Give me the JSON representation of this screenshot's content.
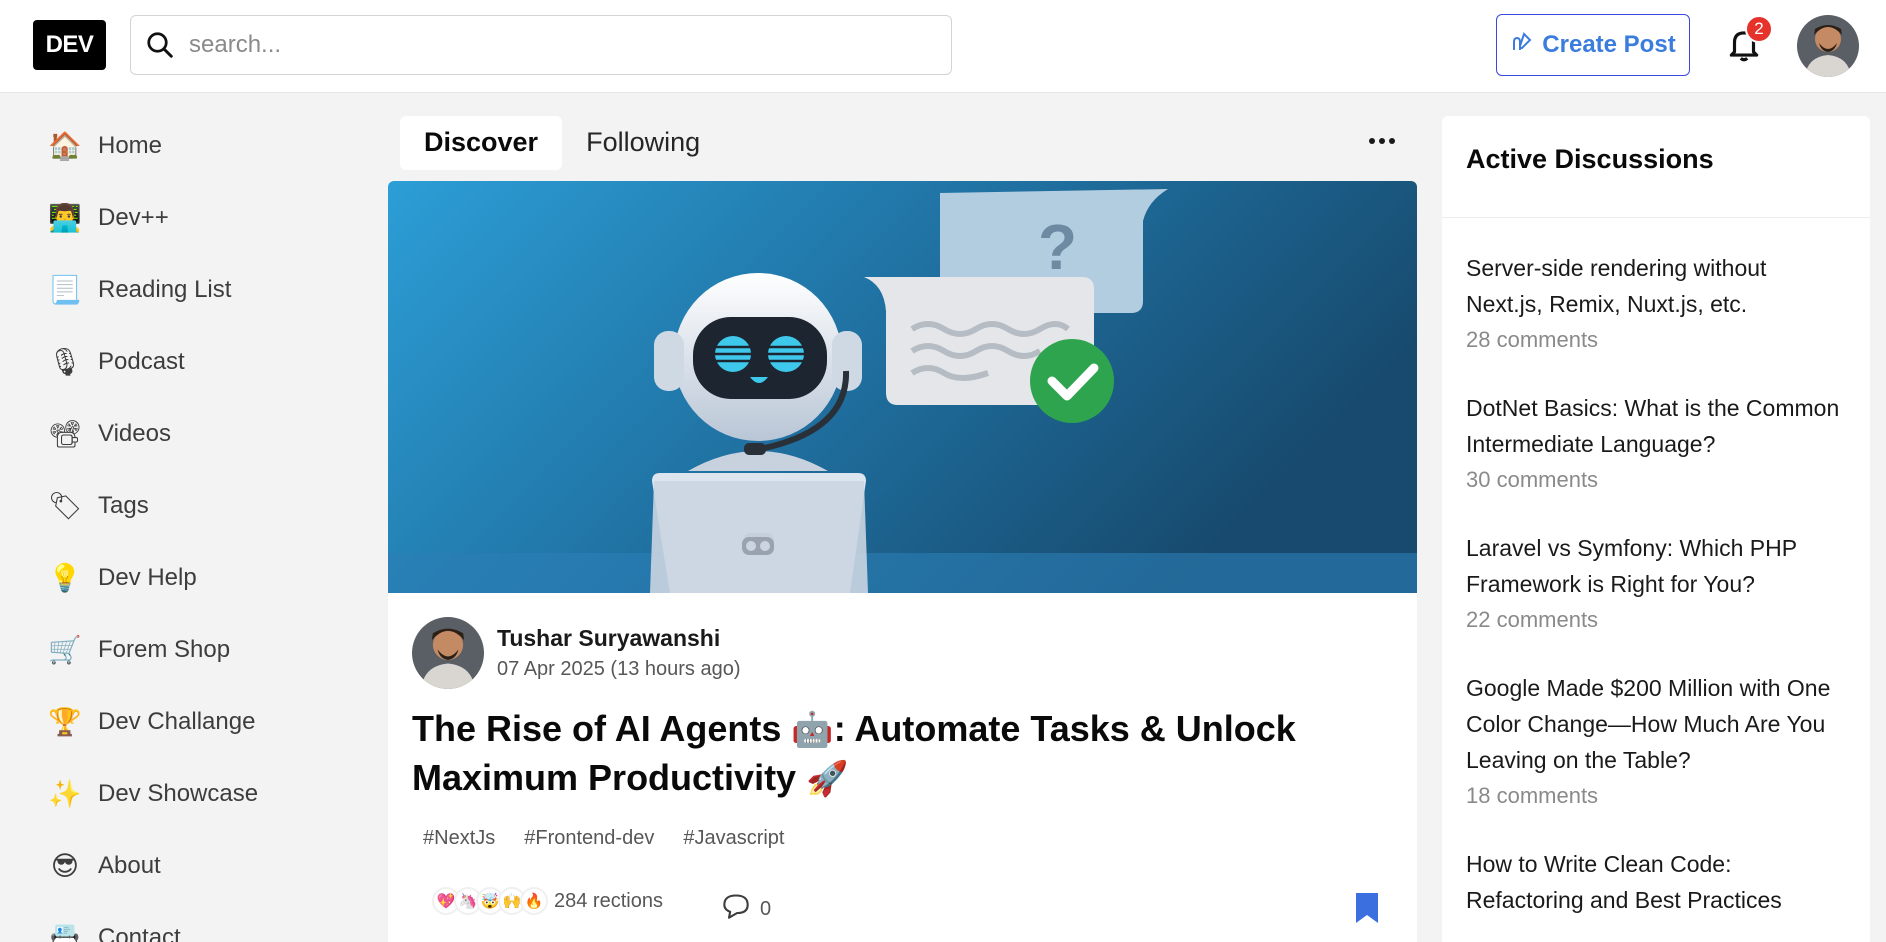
{
  "header": {
    "logo": "DEV",
    "search_placeholder": "search...",
    "create_post": "Create Post",
    "notification_count": "2"
  },
  "sidebar": {
    "items": [
      {
        "icon": "house-icon",
        "emoji": "🏠",
        "label": "Home"
      },
      {
        "icon": "developer-icon",
        "emoji": "👨‍💻",
        "label": "Dev++"
      },
      {
        "icon": "reading-list-icon",
        "emoji": "📃",
        "label": "Reading List"
      },
      {
        "icon": "microphone-icon",
        "emoji": "🎙",
        "label": "Podcast"
      },
      {
        "icon": "film-camera-icon",
        "emoji": "📽",
        "label": "Videos"
      },
      {
        "icon": "tag-icon",
        "emoji": "🏷",
        "label": "Tags"
      },
      {
        "icon": "lightbulb-icon",
        "emoji": "💡",
        "label": "Dev Help"
      },
      {
        "icon": "shopping-cart-icon",
        "emoji": "🛒",
        "label": "Forem Shop"
      },
      {
        "icon": "trophy-icon",
        "emoji": "🏆",
        "label": "Dev Challange"
      },
      {
        "icon": "sparkles-icon",
        "emoji": "✨",
        "label": "Dev Showcase"
      },
      {
        "icon": "sunglasses-icon",
        "emoji": "😎",
        "label": "About"
      },
      {
        "icon": "contact-icon",
        "emoji": "📇",
        "label": "Contact"
      }
    ]
  },
  "feed": {
    "tabs": [
      {
        "label": "Discover",
        "active": true
      },
      {
        "label": "Following",
        "active": false
      }
    ]
  },
  "post": {
    "author": "Tushar Suryawanshi",
    "date": "07 Apr 2025 (13 hours ago)",
    "title_part1": "The Rise of AI Agents ",
    "title_emoji1": "🤖",
    "title_part2": ": Automate Tasks & Unlock Maximum Productivity ",
    "title_emoji2": "🚀",
    "tags": [
      "#NextJs",
      "#Frontend-dev",
      "#Javascript"
    ],
    "reaction_emojis": [
      "💖",
      "🦄",
      "🤯",
      "🙌",
      "🔥"
    ],
    "reactions_label": "284 rections",
    "comments_count": "0",
    "accent_color": "#3b49df"
  },
  "discussions": {
    "heading": "Active Discussions",
    "items": [
      {
        "title": "Server-side rendering without Next.js, Remix, Nuxt.js, etc.",
        "comments": "28 comments"
      },
      {
        "title": "DotNet Basics: What is the Common Intermediate Language?",
        "comments": "30 comments"
      },
      {
        "title": "Laravel vs Symfony: Which PHP Framework is Right for You?",
        "comments": "22 comments"
      },
      {
        "title": "Google Made $200 Million with One Color Change—How Much Are You Leaving on the Table?",
        "comments": "18 comments"
      },
      {
        "title": "How to Write Clean Code: Refactoring and Best Practices",
        "comments": ""
      }
    ]
  }
}
